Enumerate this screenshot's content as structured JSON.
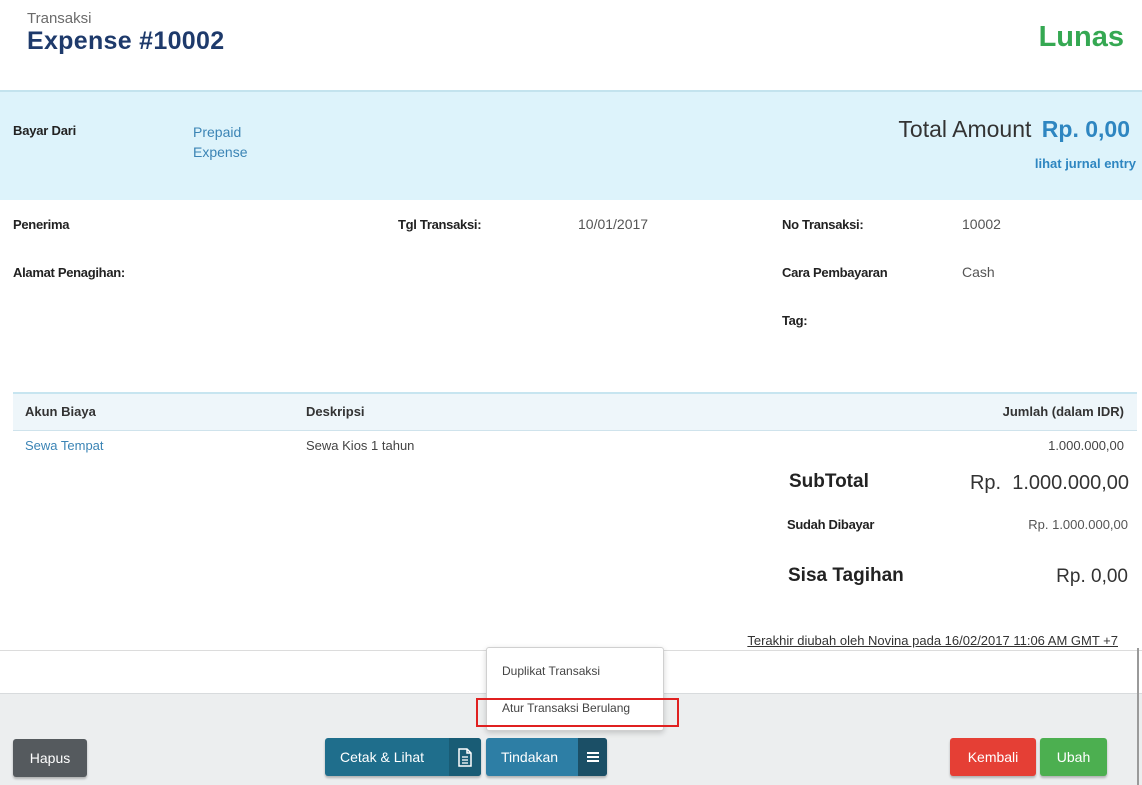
{
  "header": {
    "subtitle": "Transaksi",
    "title": "Expense #10002",
    "status": "Lunas"
  },
  "summary_panel": {
    "bayar_dari_label": "Bayar Dari",
    "bayar_dari_value_line1": "Prepaid",
    "bayar_dari_value_line2": "Expense",
    "total_label": "Total Amount",
    "total_value": "Rp. 0,00",
    "jurnal_link": "lihat jurnal entry"
  },
  "info": {
    "penerima_label": "Penerima",
    "alamat_label": "Alamat Penagihan:",
    "tgl_label": "Tgl Transaksi:",
    "tgl_value": "10/01/2017",
    "no_label": "No Transaksi:",
    "no_value": "10002",
    "cara_label": "Cara Pembayaran",
    "cara_value": "Cash",
    "tag_label": "Tag:"
  },
  "table": {
    "headers": [
      "Akun Biaya",
      "Deskripsi",
      "Jumlah (dalam IDR)"
    ],
    "rows": [
      [
        "Sewa Tempat",
        "Sewa Kios 1 tahun",
        "1.000.000,00"
      ]
    ]
  },
  "totals": {
    "subtotal_label": "SubTotal",
    "subtotal_value": "Rp.  1.000.000,00",
    "dibayar_label": "Sudah Dibayar",
    "dibayar_value": "Rp. 1.000.000,00",
    "sisa_label": "Sisa Tagihan",
    "sisa_value": "Rp. 0,00"
  },
  "footer_note": "Terakhir diubah oleh Novina pada 16/02/2017 11:06 AM GMT +7",
  "dropdown": {
    "items": [
      "Duplikat Transaksi",
      "Atur Transaksi Berulang"
    ]
  },
  "buttons": {
    "hapus": "Hapus",
    "cetak": "Cetak & Lihat",
    "tindakan": "Tindakan",
    "kembali": "Kembali",
    "ubah": "Ubah"
  },
  "colors": {
    "status_green": "#35a852",
    "accent_blue": "#2e86c1",
    "danger": "#e53f35",
    "success": "#4caf50"
  },
  "icons": [
    "document-icon",
    "menu-icon"
  ]
}
